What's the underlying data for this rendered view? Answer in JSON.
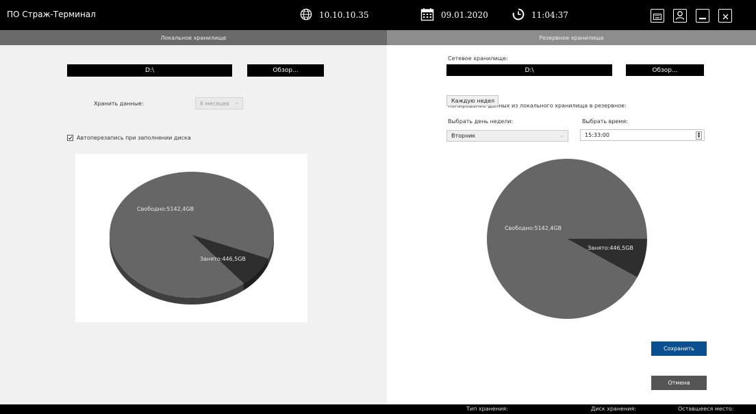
{
  "app": {
    "title": "ПО Страж-Терминал"
  },
  "topbar": {
    "ip": "10.10.10.35",
    "date": "09.01.2020",
    "time": "11:04:37"
  },
  "left": {
    "header": "Локальное хранилище",
    "path": "D:\\",
    "browse_label": "Обзор...",
    "keep_label": "Хранить данные:",
    "keep_value": "6 месяцев",
    "overwrite_label": "Автоперезапись при заполнении диска",
    "overwrite_checked": true,
    "chart": {
      "free_label": "Свободно:5142,4GB",
      "used_label": "Занято:446,5GB"
    }
  },
  "right": {
    "header": "Резервное хранилище",
    "network_label": "Сетевое хранилище:",
    "path": "D:\\",
    "browse_label": "Обзор...",
    "copy_label": "Копирование данных из локального хранилища в резервное:",
    "frequency_value": "Каждую недел",
    "day_label": "Выбрать день недели:",
    "day_value": "Вторник",
    "time_label": "Выбрать время:",
    "time_value": "15:33:00",
    "chart": {
      "free_label": "Свободно:5142,4GB",
      "used_label": "Занято:446,5GB"
    },
    "save_label": "Сохранить",
    "cancel_label": "Отмена"
  },
  "footer": {
    "type_label": "Тип хранения:",
    "disk_label": "Диск хранения:",
    "remaining_label": "Оставшееся место:"
  },
  "chart_data": [
    {
      "type": "pie",
      "slices": [
        {
          "label": "Свободно",
          "value": 5142.4,
          "text": "Свободно:5142,4GB"
        },
        {
          "label": "Занято",
          "value": 446.5,
          "text": "Занято:446,5GB"
        }
      ]
    },
    {
      "type": "pie",
      "slices": [
        {
          "label": "Свободно",
          "value": 5142.4,
          "text": "Свободно:5142,4GB"
        },
        {
          "label": "Занято",
          "value": 446.5,
          "text": "Занято:446,5GB"
        }
      ]
    }
  ],
  "colors": {
    "free": "#666666",
    "used": "#2e2e2e",
    "save_button": "#0a4f8f",
    "cancel_button": "#555555",
    "topbar": "#000000"
  }
}
